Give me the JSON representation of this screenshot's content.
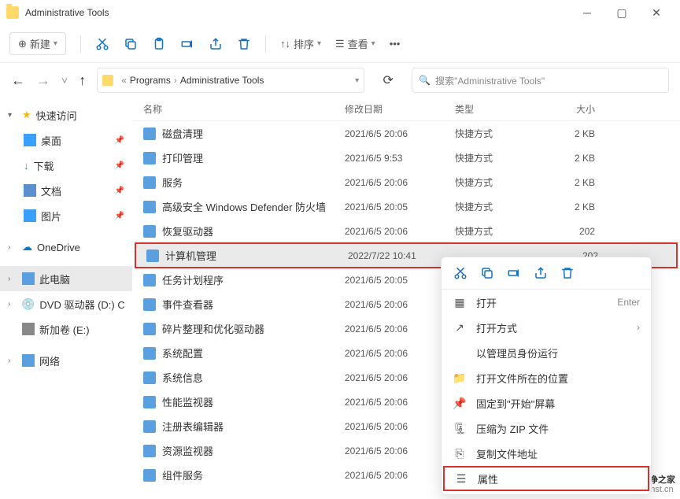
{
  "titlebar": {
    "title": "Administrative Tools"
  },
  "toolbar": {
    "new_label": "新建",
    "sort_label": "排序",
    "view_label": "查看"
  },
  "nav": {
    "crumb1": "Programs",
    "crumb2": "Administrative Tools",
    "search_placeholder": "搜索\"Administrative Tools\""
  },
  "sidebar": {
    "quick": "快速访问",
    "desktop": "桌面",
    "downloads": "下载",
    "documents": "文档",
    "pictures": "图片",
    "onedrive": "OneDrive",
    "thispc": "此电脑",
    "dvd": "DVD 驱动器 (D:) CC",
    "newvol": "新加卷 (E:)",
    "network": "网络"
  },
  "columns": {
    "name": "名称",
    "date": "修改日期",
    "type": "类型",
    "size": "大小"
  },
  "files": [
    {
      "name": "磁盘清理",
      "date": "2021/6/5 20:06",
      "type": "快捷方式",
      "size": "2 KB"
    },
    {
      "name": "打印管理",
      "date": "2021/6/5 9:53",
      "type": "快捷方式",
      "size": "2 KB"
    },
    {
      "name": "服务",
      "date": "2021/6/5 20:06",
      "type": "快捷方式",
      "size": "2 KB"
    },
    {
      "name": "高级安全 Windows Defender 防火墙",
      "date": "2021/6/5 20:05",
      "type": "快捷方式",
      "size": "2 KB"
    },
    {
      "name": "恢复驱动器",
      "date": "2021/6/5 20:06",
      "type": "快捷方式",
      "size": "202"
    },
    {
      "name": "计算机管理",
      "date": "2022/7/22 10:41",
      "type": "",
      "size": "202"
    },
    {
      "name": "任务计划程序",
      "date": "2021/6/5 20:05",
      "type": "",
      "size": ""
    },
    {
      "name": "事件查看器",
      "date": "2021/6/5 20:06",
      "type": "",
      "size": ""
    },
    {
      "name": "碎片整理和优化驱动器",
      "date": "2021/6/5 20:06",
      "type": "",
      "size": ""
    },
    {
      "name": "系统配置",
      "date": "2021/6/5 20:06",
      "type": "",
      "size": ""
    },
    {
      "name": "系统信息",
      "date": "2021/6/5 20:06",
      "type": "",
      "size": ""
    },
    {
      "name": "性能监视器",
      "date": "2021/6/5 20:06",
      "type": "",
      "size": ""
    },
    {
      "name": "注册表编辑器",
      "date": "2021/6/5 20:06",
      "type": "",
      "size": ""
    },
    {
      "name": "资源监视器",
      "date": "2021/6/5 20:06",
      "type": "",
      "size": ""
    },
    {
      "name": "组件服务",
      "date": "2021/6/5 20:06",
      "type": "",
      "size": ""
    }
  ],
  "contextmenu": {
    "open": "打开",
    "open_accel": "Enter",
    "openwith": "打开方式",
    "runas": "以管理员身份运行",
    "openloc": "打开文件所在的位置",
    "pin": "固定到\"开始\"屏幕",
    "zip": "压缩为 ZIP 文件",
    "copypath": "复制文件地址",
    "properties": "属性"
  },
  "watermark": {
    "text": "纯净之家",
    "url": "gdhst.cn"
  }
}
